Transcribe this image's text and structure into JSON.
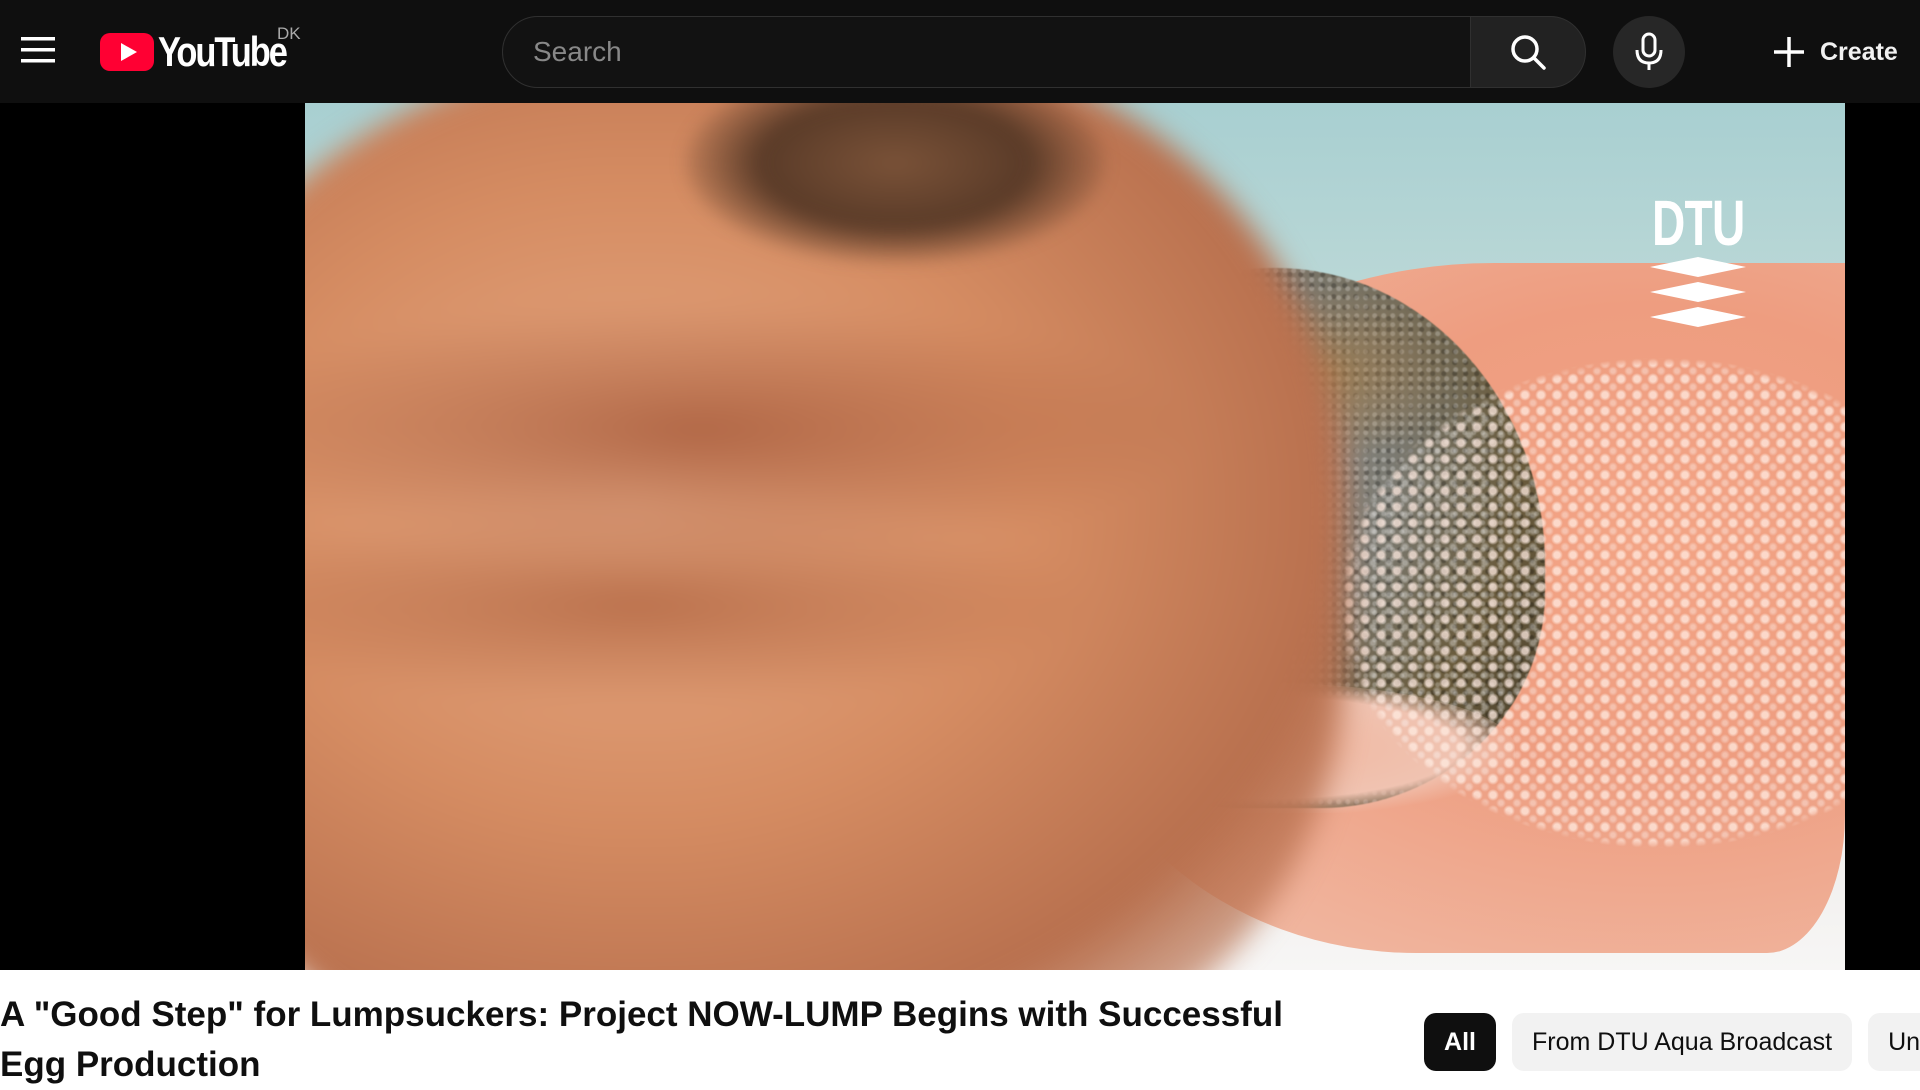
{
  "masthead": {
    "logo_text": "YouTube",
    "country_code": "DK",
    "search_placeholder": "Search",
    "search_value": "",
    "create_label": "Create",
    "icons": [
      "menu-icon",
      "youtube-logo",
      "search-icon",
      "mic-icon",
      "plus-icon"
    ],
    "brand_red": "#ff0033",
    "background": "#0f0f0f"
  },
  "player": {
    "watermark_text": "DTU"
  },
  "video": {
    "title": "A \"Good Step\" for Lumpsuckers: Project NOW-LUMP Begins with Successful Egg Production"
  },
  "chips": [
    "All",
    "From DTU Aqua Broadcast",
    "Un"
  ]
}
